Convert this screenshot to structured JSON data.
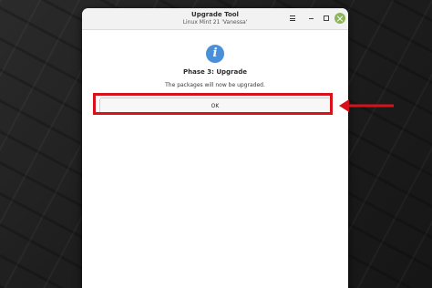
{
  "window": {
    "title": "Upgrade Tool",
    "subtitle": "Linux Mint 21 'Vanessa'"
  },
  "dialog": {
    "icon": "info-icon",
    "heading": "Phase 3: Upgrade",
    "message": "The packages will now be upgraded.",
    "ok_label": "OK"
  },
  "annotation": {
    "color": "#d8121b"
  },
  "colors": {
    "close_button": "#8fb55a",
    "info_icon": "#4a90d9"
  }
}
